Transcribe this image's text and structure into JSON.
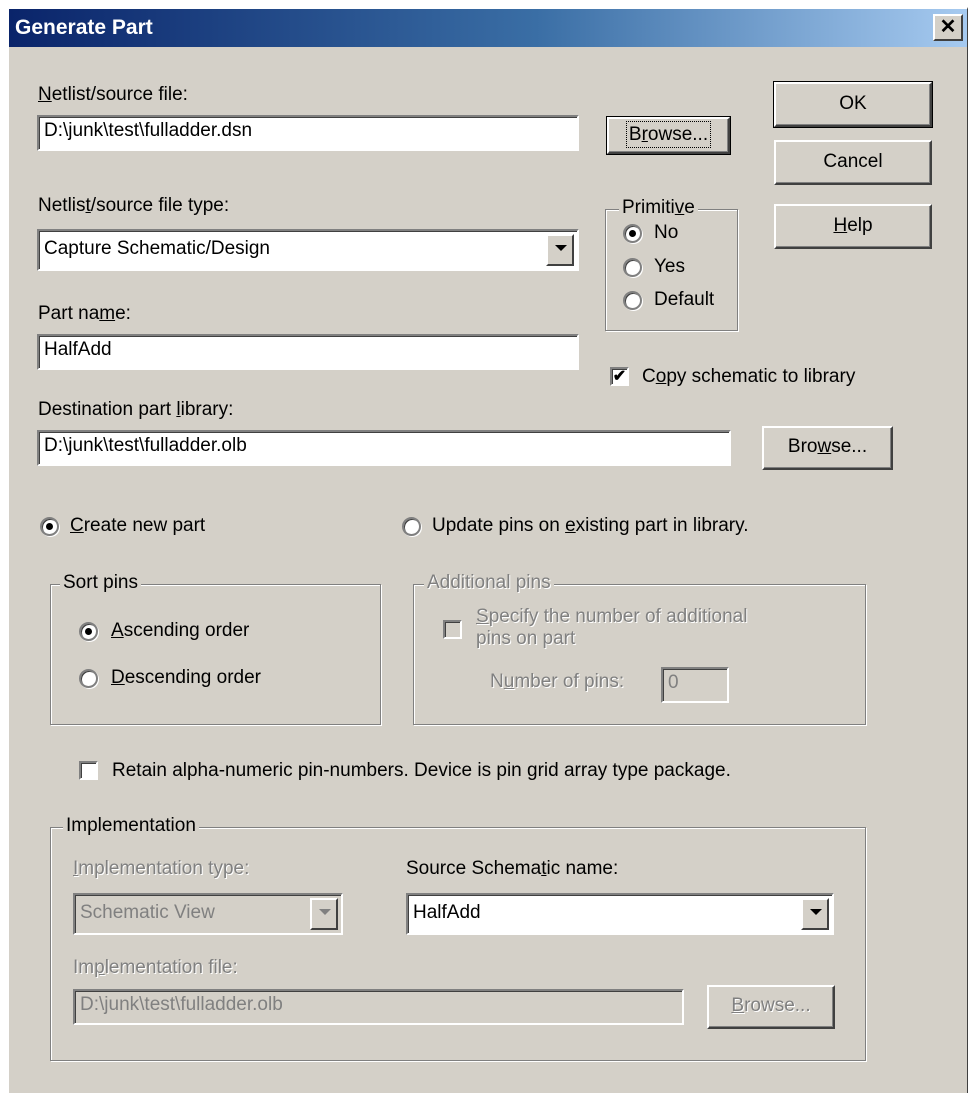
{
  "window": {
    "title": "Generate Part",
    "close_glyph": "✕"
  },
  "netlist": {
    "label_u": "N",
    "label_rest": "etlist/source file:",
    "value": "D:\\junk\\test\\fulladder.dsn",
    "browse_u": "r",
    "browse_pre": "B",
    "browse_post": "owse..."
  },
  "buttons": {
    "ok": "OK",
    "cancel": "Cancel",
    "help_u": "H",
    "help_rest": "elp"
  },
  "filetype": {
    "label_pre": "Netlis",
    "label_u": "t",
    "label_post": "/source file type:",
    "value": "Capture Schematic/Design"
  },
  "primitive": {
    "legend_pre": "Primiti",
    "legend_u": "v",
    "legend_post": "e",
    "options": [
      "No",
      "Yes",
      "Default"
    ],
    "selected": 0
  },
  "partname": {
    "label_pre": "Part na",
    "label_u": "m",
    "label_post": "e:",
    "value": "HalfAdd"
  },
  "copy_schematic": {
    "label_pre": "C",
    "label_u": "o",
    "label_post": "py schematic to library",
    "checked": true,
    "check_glyph": "✔"
  },
  "destination": {
    "label_pre": "Destination part ",
    "label_u": "l",
    "label_post": "ibrary:",
    "value": "D:\\junk\\test\\fulladder.olb",
    "browse_pre": "Bro",
    "browse_u": "w",
    "browse_post": "se..."
  },
  "mode": {
    "create_u": "C",
    "create_rest": "reate new part",
    "update_pre": "Update pins on ",
    "update_u": "e",
    "update_post": "xisting part in library.",
    "selected": "create"
  },
  "sort_pins": {
    "legend": "Sort pins",
    "asc_u": "A",
    "asc_rest": "scending order",
    "desc_u": "D",
    "desc_rest": "escending order",
    "selected": "ascending"
  },
  "additional_pins": {
    "legend": "Additional pins",
    "specify_u": "S",
    "specify_line1": "pecify the number of additional",
    "specify_line2": "pins on part",
    "num_pre": "N",
    "num_u": "u",
    "num_post": "mber of pins:",
    "num_value": "0"
  },
  "retain": {
    "label": "Retain alpha-numeric pin-numbers. Device is pin grid array type package.",
    "checked": false
  },
  "implementation": {
    "legend": "Implementation",
    "type_u": "I",
    "type_rest": "mplementation type:",
    "type_value": "Schematic View",
    "source_pre": "Source Schema",
    "source_u": "t",
    "source_post": "ic name:",
    "source_value": "HalfAdd",
    "file_pre": "Im",
    "file_u": "p",
    "file_post": "lementation file:",
    "file_value": "D:\\junk\\test\\fulladder.olb",
    "browse_u": "B",
    "browse_rest": "rowse..."
  }
}
